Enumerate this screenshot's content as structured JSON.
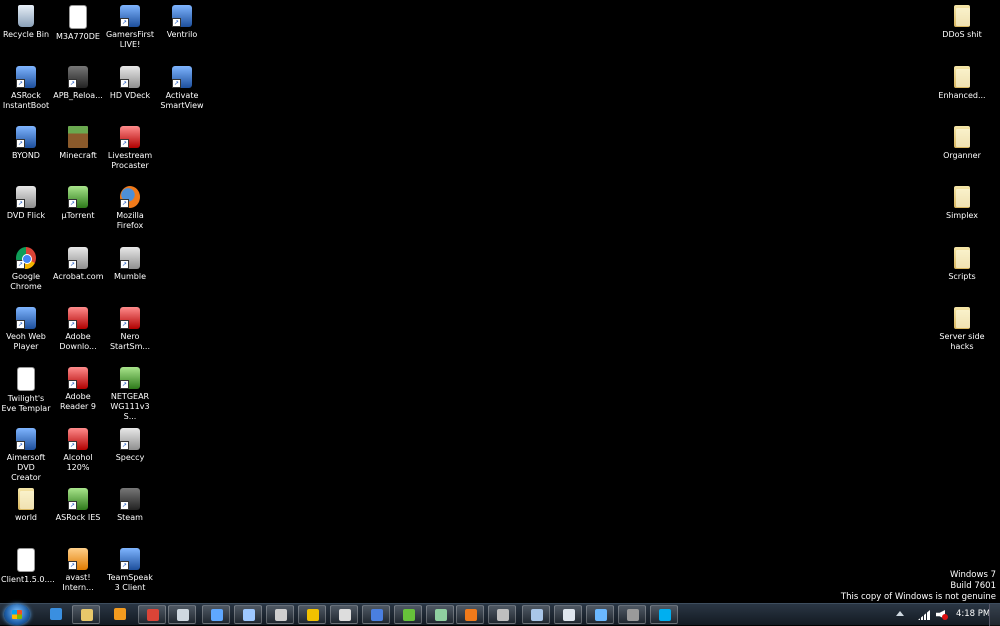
{
  "desktop_icons": [
    {
      "label": "Recycle Bin",
      "icon": "recycle-bin-icon",
      "style": "recycle",
      "shortcut": false
    },
    {
      "label": "M3A770DE",
      "icon": "document-icon",
      "style": "paper",
      "shortcut": false
    },
    {
      "label": "GamersFirst LIVE!",
      "icon": "gamersfirst-icon",
      "style": "blue",
      "shortcut": true
    },
    {
      "label": "Ventrilo",
      "icon": "ventrilo-icon",
      "style": "blue",
      "shortcut": true
    },
    {
      "label": "ASRock InstantBoot",
      "icon": "asrock-instantboot-icon",
      "style": "blue",
      "shortcut": true
    },
    {
      "label": "APB_Reloa...",
      "icon": "apb-reloaded-icon",
      "style": "dark",
      "shortcut": true
    },
    {
      "label": "HD VDeck",
      "icon": "hd-vdeck-icon",
      "style": "generic",
      "shortcut": true
    },
    {
      "label": "Activate SmartView",
      "icon": "smartview-icon",
      "style": "blue",
      "shortcut": true
    },
    {
      "label": "BYOND",
      "icon": "byond-icon",
      "style": "blue",
      "shortcut": true
    },
    {
      "label": "Minecraft",
      "icon": "minecraft-icon",
      "style": "mc",
      "shortcut": false
    },
    {
      "label": "Livestream Procaster",
      "icon": "livestream-icon",
      "style": "red",
      "shortcut": true
    },
    {
      "label": "DVD Flick",
      "icon": "dvd-flick-icon",
      "style": "generic",
      "shortcut": true
    },
    {
      "label": "µTorrent",
      "icon": "utorrent-icon",
      "style": "green",
      "shortcut": true
    },
    {
      "label": "Mozilla Firefox",
      "icon": "firefox-icon",
      "style": "firefox",
      "shortcut": true
    },
    {
      "label": "Google Chrome",
      "icon": "chrome-icon",
      "style": "chrome",
      "shortcut": true
    },
    {
      "label": "Acrobat.com",
      "icon": "acrobat-com-icon",
      "style": "generic",
      "shortcut": true
    },
    {
      "label": "Mumble",
      "icon": "mumble-icon",
      "style": "generic",
      "shortcut": true
    },
    {
      "label": "Veoh Web Player",
      "icon": "veoh-icon",
      "style": "blue",
      "shortcut": true
    },
    {
      "label": "Adobe Downlo...",
      "icon": "adobe-download-icon",
      "style": "red",
      "shortcut": true
    },
    {
      "label": "Nero StartSm...",
      "icon": "nero-icon",
      "style": "red",
      "shortcut": true
    },
    {
      "label": "Twilight's Eve Templar",
      "icon": "document-icon",
      "style": "paper",
      "shortcut": false
    },
    {
      "label": "Adobe Reader 9",
      "icon": "adobe-reader-icon",
      "style": "red",
      "shortcut": true
    },
    {
      "label": "NETGEAR WG111v3 S...",
      "icon": "netgear-icon",
      "style": "green",
      "shortcut": true
    },
    {
      "label": "Aimersoft DVD Creator",
      "icon": "aimersoft-icon",
      "style": "blue",
      "shortcut": true
    },
    {
      "label": "Alcohol 120%",
      "icon": "alcohol-icon",
      "style": "red",
      "shortcut": true
    },
    {
      "label": "Speccy",
      "icon": "speccy-icon",
      "style": "generic",
      "shortcut": true
    },
    {
      "label": "world",
      "icon": "folder-icon",
      "style": "folder",
      "shortcut": false
    },
    {
      "label": "ASRock IES",
      "icon": "asrock-ies-icon",
      "style": "green",
      "shortcut": true
    },
    {
      "label": "Steam",
      "icon": "steam-icon",
      "style": "dark",
      "shortcut": true
    },
    {
      "label": "Client1.5.0....",
      "icon": "archive-icon",
      "style": "paper",
      "shortcut": false
    },
    {
      "label": "avast! Intern...",
      "icon": "avast-icon",
      "style": "orange",
      "shortcut": true
    },
    {
      "label": "TeamSpeak 3 Client",
      "icon": "teamspeak-icon",
      "style": "blue",
      "shortcut": true
    }
  ],
  "right_icons": [
    {
      "label": "DDoS shit",
      "icon": "folder-icon"
    },
    {
      "label": "Enhanced...",
      "icon": "folder-icon"
    },
    {
      "label": "Organner",
      "icon": "folder-icon"
    },
    {
      "label": "Simplex",
      "icon": "folder-icon"
    },
    {
      "label": "Scripts",
      "icon": "folder-icon"
    },
    {
      "label": "Server side hacks",
      "icon": "folder-icon"
    }
  ],
  "watermark": {
    "line1": "Windows 7",
    "line2": "Build 7601",
    "line3": "This copy of Windows is not genuine"
  },
  "taskbar": {
    "start_icon": "windows-start-icon",
    "items": [
      {
        "icon": "internet-explorer-icon",
        "color": "#3a8fe0",
        "open": false
      },
      {
        "icon": "windows-explorer-icon",
        "color": "#e8c86a",
        "open": true
      },
      {
        "icon": "media-player-icon",
        "color": "#f39b1f",
        "open": false
      },
      {
        "icon": "chrome-icon",
        "color": "#db4437",
        "open": true
      },
      {
        "icon": "notepad-icon",
        "color": "#cfd8e0",
        "open": true
      },
      {
        "icon": "network-icon",
        "color": "#5fa8ff",
        "open": true
      },
      {
        "icon": "app-icon",
        "color": "#9ec8ff",
        "open": true
      },
      {
        "icon": "terminal-icon",
        "color": "#cfcfcf",
        "open": true
      },
      {
        "icon": "winamp-icon",
        "color": "#f2c200",
        "open": true
      },
      {
        "icon": "mumble-icon",
        "color": "#dddddd",
        "open": true
      },
      {
        "icon": "bars-icon",
        "color": "#4a7fe0",
        "open": true
      },
      {
        "icon": "ball-icon",
        "color": "#67c23a",
        "open": true
      },
      {
        "icon": "map-icon",
        "color": "#8fd0a0",
        "open": true
      },
      {
        "icon": "firefox-icon",
        "color": "#f07a1a",
        "open": true
      },
      {
        "icon": "steam-icon",
        "color": "#bfbfbf",
        "open": true
      },
      {
        "icon": "ventrilo-icon",
        "color": "#a9c6e8",
        "open": true
      },
      {
        "icon": "paint-icon",
        "color": "#dfe6ee",
        "open": true
      },
      {
        "icon": "photo-icon",
        "color": "#6bb8ff",
        "open": true
      },
      {
        "icon": "tool-icon",
        "color": "#9a9a9a",
        "open": true
      },
      {
        "icon": "skype-icon",
        "color": "#00aff0",
        "open": true
      }
    ],
    "clock": "4:18 PM"
  }
}
